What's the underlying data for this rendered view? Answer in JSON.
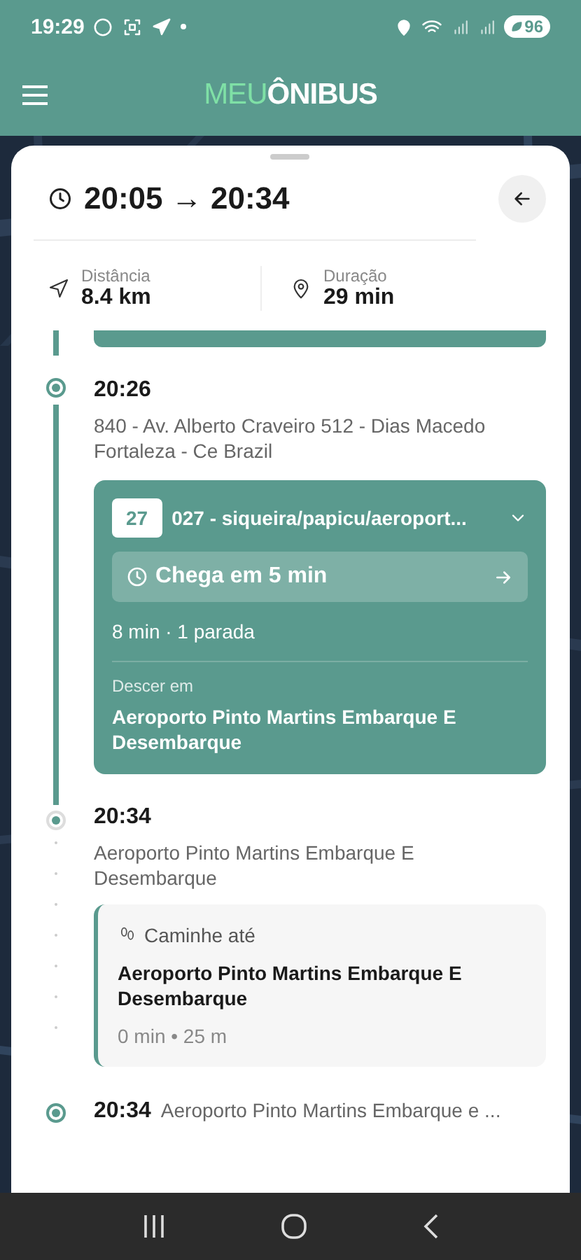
{
  "status_bar": {
    "time": "19:29",
    "battery": "96"
  },
  "app_bar": {
    "logo_light": "MEU",
    "logo_bold": "ÔNIBUS"
  },
  "trip": {
    "times": "20:05 → 20:34",
    "distance": {
      "label": "Distância",
      "value": "8.4 km"
    },
    "duration": {
      "label": "Duração",
      "value": "29 min"
    }
  },
  "stops": [
    {
      "time": "20:26",
      "address": "840 - Av. Alberto Craveiro 512 - Dias Macedo Fortaleza - Ce Brazil",
      "highlighted": true,
      "kind": "boarding",
      "leg": {
        "kind": "bus",
        "route_number": "27",
        "route_name": "027 - siqueira/papicu/aeroport...",
        "arrival": "Chega em 5 min",
        "summary": "8 min · 1 parada",
        "alight_label": "Descer em",
        "alight_stop": "Aeroporto Pinto Martins Embarque E Desembarque"
      }
    },
    {
      "time": "20:34",
      "address": "Aeroporto Pinto Martins Embarque E Desembarque",
      "highlighted": false,
      "kind": "alighting",
      "leg": {
        "kind": "walk",
        "title": "Caminhe até",
        "destination": "Aeroporto Pinto Martins Embarque E Desembarque",
        "summary": "0 min • 25 m"
      }
    },
    {
      "time": "20:34",
      "address": "Aeroporto Pinto Martins Embarque e ...",
      "highlighted": true,
      "kind": "destination"
    }
  ]
}
